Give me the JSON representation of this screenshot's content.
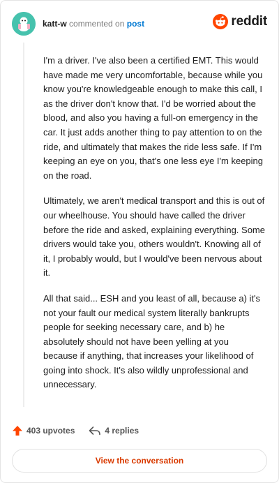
{
  "header": {
    "username": "katt-w",
    "commented_on": "commented on",
    "post_link": "post",
    "brand": "reddit"
  },
  "comment": {
    "paragraphs": [
      "I'm a driver. I've also been a certified EMT. This would have made me very uncomfortable, because while you know you're knowledgeable enough to make this call, I as the driver don't know that. I'd be worried about the blood, and also you having a full-on emergency in the car. It just adds another thing to pay attention to on the ride, and ultimately that makes the ride less safe. If I'm keeping an eye on you, that's one less eye I'm keeping on the road.",
      "Ultimately, we aren't medical transport and this is out of our wheelhouse. You should have called the driver before the ride and asked, explaining everything. Some drivers would take you, others wouldn't. Knowing all of it, I probably would, but I would've been nervous about it.",
      "All that said... ESH and you least of all, because a) it's not your fault our medical system literally bankrupts people for seeking necessary care, and b) he absolutely should not have been yelling at you because if anything, that increases your likelihood of going into shock. It's also wildly unprofessional and unnecessary."
    ]
  },
  "actions": {
    "upvotes": "403 upvotes",
    "replies": "4 replies"
  },
  "cta": {
    "label": "View the conversation"
  },
  "icons": {
    "avatar": "snoo-avatar-icon",
    "brand": "reddit-logo-icon",
    "upvote": "upvote-arrow-icon",
    "reply": "reply-arrow-icon"
  },
  "colors": {
    "accent": "#d93a00",
    "upvote": "#ff4500",
    "link": "#0079d3",
    "avatar_bg": "#46c2ad"
  }
}
